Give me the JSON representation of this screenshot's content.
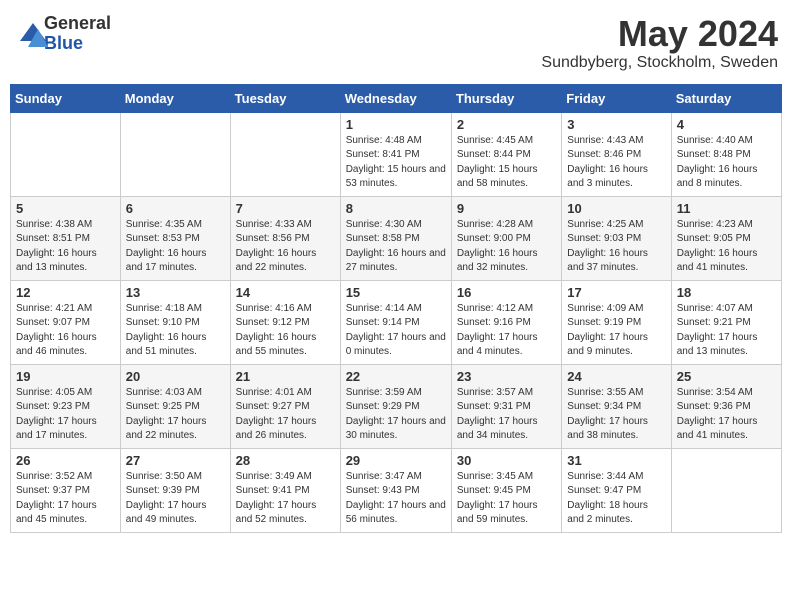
{
  "header": {
    "logo_general": "General",
    "logo_blue": "Blue",
    "month_title": "May 2024",
    "location": "Sundbyberg, Stockholm, Sweden"
  },
  "weekdays": [
    "Sunday",
    "Monday",
    "Tuesday",
    "Wednesday",
    "Thursday",
    "Friday",
    "Saturday"
  ],
  "weeks": [
    [
      {
        "day": "",
        "info": ""
      },
      {
        "day": "",
        "info": ""
      },
      {
        "day": "",
        "info": ""
      },
      {
        "day": "1",
        "info": "Sunrise: 4:48 AM\nSunset: 8:41 PM\nDaylight: 15 hours and 53 minutes."
      },
      {
        "day": "2",
        "info": "Sunrise: 4:45 AM\nSunset: 8:44 PM\nDaylight: 15 hours and 58 minutes."
      },
      {
        "day": "3",
        "info": "Sunrise: 4:43 AM\nSunset: 8:46 PM\nDaylight: 16 hours and 3 minutes."
      },
      {
        "day": "4",
        "info": "Sunrise: 4:40 AM\nSunset: 8:48 PM\nDaylight: 16 hours and 8 minutes."
      }
    ],
    [
      {
        "day": "5",
        "info": "Sunrise: 4:38 AM\nSunset: 8:51 PM\nDaylight: 16 hours and 13 minutes."
      },
      {
        "day": "6",
        "info": "Sunrise: 4:35 AM\nSunset: 8:53 PM\nDaylight: 16 hours and 17 minutes."
      },
      {
        "day": "7",
        "info": "Sunrise: 4:33 AM\nSunset: 8:56 PM\nDaylight: 16 hours and 22 minutes."
      },
      {
        "day": "8",
        "info": "Sunrise: 4:30 AM\nSunset: 8:58 PM\nDaylight: 16 hours and 27 minutes."
      },
      {
        "day": "9",
        "info": "Sunrise: 4:28 AM\nSunset: 9:00 PM\nDaylight: 16 hours and 32 minutes."
      },
      {
        "day": "10",
        "info": "Sunrise: 4:25 AM\nSunset: 9:03 PM\nDaylight: 16 hours and 37 minutes."
      },
      {
        "day": "11",
        "info": "Sunrise: 4:23 AM\nSunset: 9:05 PM\nDaylight: 16 hours and 41 minutes."
      }
    ],
    [
      {
        "day": "12",
        "info": "Sunrise: 4:21 AM\nSunset: 9:07 PM\nDaylight: 16 hours and 46 minutes."
      },
      {
        "day": "13",
        "info": "Sunrise: 4:18 AM\nSunset: 9:10 PM\nDaylight: 16 hours and 51 minutes."
      },
      {
        "day": "14",
        "info": "Sunrise: 4:16 AM\nSunset: 9:12 PM\nDaylight: 16 hours and 55 minutes."
      },
      {
        "day": "15",
        "info": "Sunrise: 4:14 AM\nSunset: 9:14 PM\nDaylight: 17 hours and 0 minutes."
      },
      {
        "day": "16",
        "info": "Sunrise: 4:12 AM\nSunset: 9:16 PM\nDaylight: 17 hours and 4 minutes."
      },
      {
        "day": "17",
        "info": "Sunrise: 4:09 AM\nSunset: 9:19 PM\nDaylight: 17 hours and 9 minutes."
      },
      {
        "day": "18",
        "info": "Sunrise: 4:07 AM\nSunset: 9:21 PM\nDaylight: 17 hours and 13 minutes."
      }
    ],
    [
      {
        "day": "19",
        "info": "Sunrise: 4:05 AM\nSunset: 9:23 PM\nDaylight: 17 hours and 17 minutes."
      },
      {
        "day": "20",
        "info": "Sunrise: 4:03 AM\nSunset: 9:25 PM\nDaylight: 17 hours and 22 minutes."
      },
      {
        "day": "21",
        "info": "Sunrise: 4:01 AM\nSunset: 9:27 PM\nDaylight: 17 hours and 26 minutes."
      },
      {
        "day": "22",
        "info": "Sunrise: 3:59 AM\nSunset: 9:29 PM\nDaylight: 17 hours and 30 minutes."
      },
      {
        "day": "23",
        "info": "Sunrise: 3:57 AM\nSunset: 9:31 PM\nDaylight: 17 hours and 34 minutes."
      },
      {
        "day": "24",
        "info": "Sunrise: 3:55 AM\nSunset: 9:34 PM\nDaylight: 17 hours and 38 minutes."
      },
      {
        "day": "25",
        "info": "Sunrise: 3:54 AM\nSunset: 9:36 PM\nDaylight: 17 hours and 41 minutes."
      }
    ],
    [
      {
        "day": "26",
        "info": "Sunrise: 3:52 AM\nSunset: 9:37 PM\nDaylight: 17 hours and 45 minutes."
      },
      {
        "day": "27",
        "info": "Sunrise: 3:50 AM\nSunset: 9:39 PM\nDaylight: 17 hours and 49 minutes."
      },
      {
        "day": "28",
        "info": "Sunrise: 3:49 AM\nSunset: 9:41 PM\nDaylight: 17 hours and 52 minutes."
      },
      {
        "day": "29",
        "info": "Sunrise: 3:47 AM\nSunset: 9:43 PM\nDaylight: 17 hours and 56 minutes."
      },
      {
        "day": "30",
        "info": "Sunrise: 3:45 AM\nSunset: 9:45 PM\nDaylight: 17 hours and 59 minutes."
      },
      {
        "day": "31",
        "info": "Sunrise: 3:44 AM\nSunset: 9:47 PM\nDaylight: 18 hours and 2 minutes."
      },
      {
        "day": "",
        "info": ""
      }
    ]
  ]
}
